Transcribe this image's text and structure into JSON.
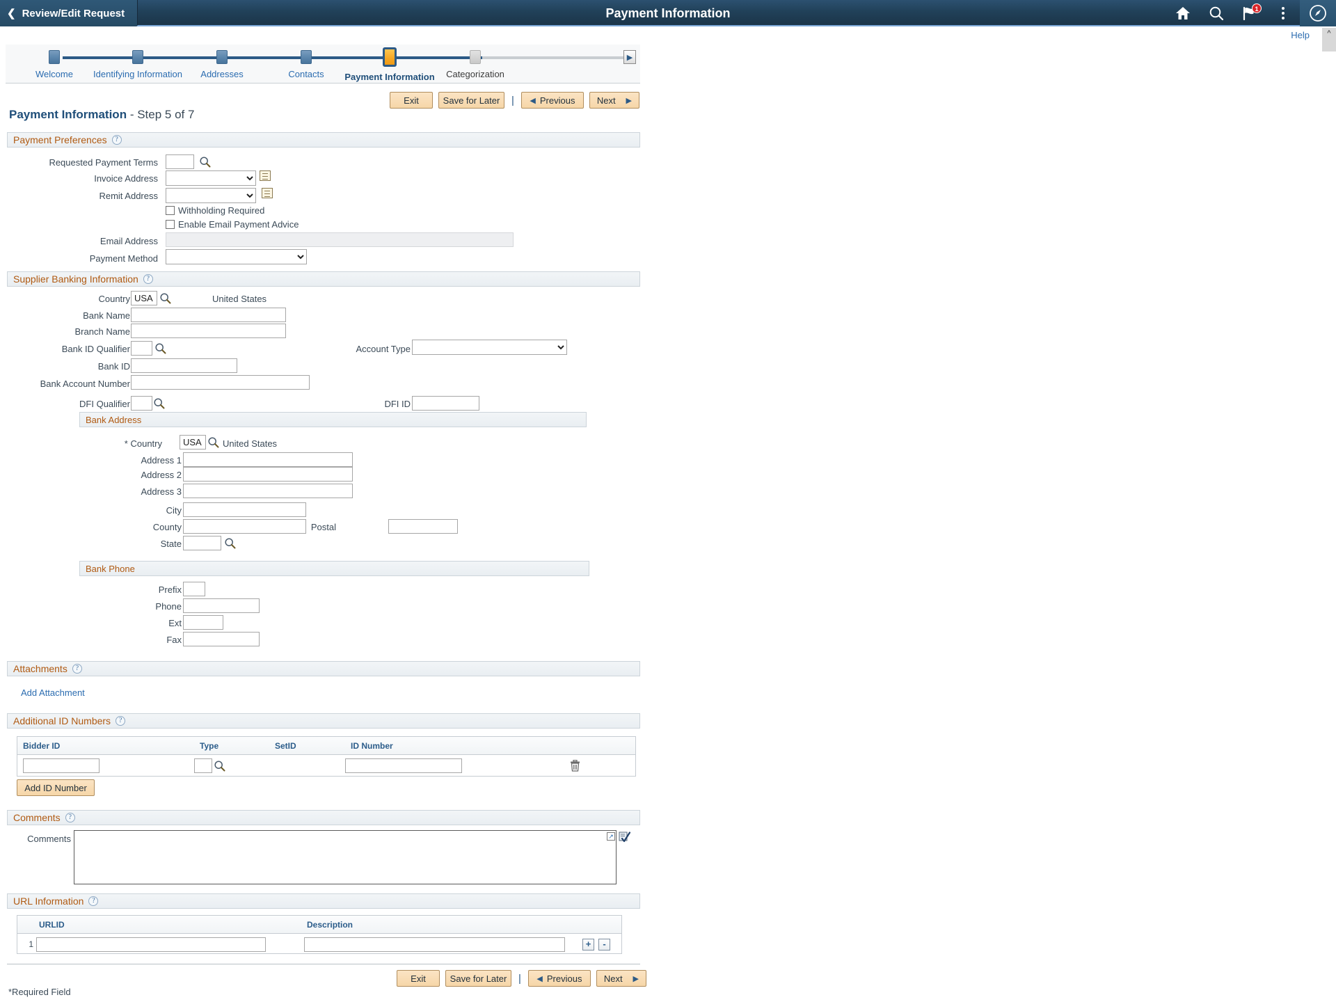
{
  "header": {
    "back_label": "Review/Edit Request",
    "title": "Payment Information",
    "icons": {
      "home": "home-icon",
      "search": "search-icon",
      "notifications": "flag-notification-icon",
      "notification_count": "1",
      "actions": "kebab-menu-icon",
      "nav_bar": "compass-navbar-icon"
    }
  },
  "help": {
    "label": "Help",
    "collapse": "^"
  },
  "train": {
    "steps": [
      {
        "label": "Welcome",
        "state": "done"
      },
      {
        "label": "Identifying Information",
        "state": "done"
      },
      {
        "label": "Addresses",
        "state": "done"
      },
      {
        "label": "Contacts",
        "state": "done"
      },
      {
        "label": "Payment Information",
        "state": "current"
      },
      {
        "label": "Categorization",
        "state": "future"
      }
    ],
    "next_arrow": "▶"
  },
  "toolbar": {
    "exit": "Exit",
    "save_for_later": "Save for Later",
    "separator": "|",
    "previous": "Previous",
    "next": "Next",
    "prev_arrow": "◀",
    "next_arrow": "▶"
  },
  "page": {
    "title": "Payment Information",
    "step_text": "- Step 5 of 7"
  },
  "payment_preferences": {
    "heading": "Payment Preferences",
    "requested_payment_terms": {
      "label": "Requested Payment Terms",
      "value": ""
    },
    "invoice_address": {
      "label": "Invoice Address",
      "value": ""
    },
    "remit_address": {
      "label": "Remit Address",
      "value": ""
    },
    "withholding_required": {
      "label": "Withholding Required",
      "checked": false
    },
    "enable_email_payment_advice": {
      "label": "Enable Email Payment Advice",
      "checked": false
    },
    "email_address": {
      "label": "Email Address",
      "value": ""
    },
    "payment_method": {
      "label": "Payment Method",
      "value": ""
    }
  },
  "supplier_banking": {
    "heading": "Supplier Banking Information",
    "country": {
      "label": "Country",
      "value": "USA",
      "description": "United States"
    },
    "bank_name": {
      "label": "Bank Name",
      "value": ""
    },
    "branch_name": {
      "label": "Branch Name",
      "value": ""
    },
    "bank_id_qualifier": {
      "label": "Bank ID Qualifier",
      "value": ""
    },
    "account_type": {
      "label": "Account Type",
      "value": ""
    },
    "bank_id": {
      "label": "Bank ID",
      "value": ""
    },
    "bank_account_number": {
      "label": "Bank Account Number",
      "value": ""
    },
    "dfi_qualifier": {
      "label": "DFI Qualifier",
      "value": ""
    },
    "dfi_id": {
      "label": "DFI ID",
      "value": ""
    }
  },
  "bank_address": {
    "heading": "Bank Address",
    "country": {
      "label": "Country",
      "value": "USA",
      "description": "United States",
      "required": true
    },
    "address1": {
      "label": "Address 1",
      "value": ""
    },
    "address2": {
      "label": "Address 2",
      "value": ""
    },
    "address3": {
      "label": "Address 3",
      "value": ""
    },
    "city": {
      "label": "City",
      "value": ""
    },
    "county": {
      "label": "County",
      "value": ""
    },
    "postal": {
      "label": "Postal",
      "value": ""
    },
    "state": {
      "label": "State",
      "value": ""
    }
  },
  "bank_phone": {
    "heading": "Bank Phone",
    "prefix": {
      "label": "Prefix",
      "value": ""
    },
    "phone": {
      "label": "Phone",
      "value": ""
    },
    "ext": {
      "label": "Ext",
      "value": ""
    },
    "fax": {
      "label": "Fax",
      "value": ""
    }
  },
  "attachments": {
    "heading": "Attachments",
    "add_attachment": "Add Attachment"
  },
  "additional_ids": {
    "heading": "Additional ID Numbers",
    "columns": [
      "Bidder ID",
      "Type",
      "SetID",
      "ID Number"
    ],
    "rows": [
      {
        "bidder_id": "",
        "type": "",
        "setid": "",
        "id_number": ""
      }
    ],
    "add_button": "Add ID Number",
    "delete_icon": "trash-icon"
  },
  "comments": {
    "heading": "Comments",
    "label": "Comments",
    "value": "",
    "expand_icon": "expand-icon",
    "spellcheck_icon": "spellcheck-icon"
  },
  "url_information": {
    "heading": "URL Information",
    "columns": [
      "URLID",
      "Description"
    ],
    "rows": [
      {
        "num": "1",
        "urlid": "",
        "description": ""
      }
    ],
    "add_row": "+",
    "remove_row": "-"
  },
  "footer": {
    "required_note": "*Required Field"
  }
}
